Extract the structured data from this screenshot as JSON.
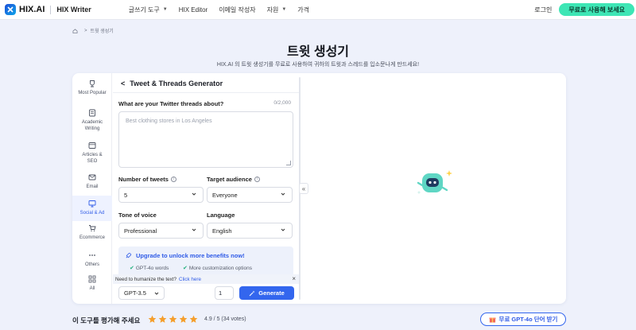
{
  "nav": {
    "logo_text": "HIX.AI",
    "product": "HIX Writer",
    "links": [
      "글쓰기 도구",
      "HIX Editor",
      "이메일 작성자",
      "자원",
      "가격"
    ],
    "login": "로그인",
    "cta": "무료로 사용해 보세요"
  },
  "breadcrumb": {
    "current": "트윗 생성기"
  },
  "header": {
    "title": "트윗 생성기",
    "subtitle": "HIX.AI 의 트윗 생성기를 무료로 사용하여 귀하의 트윗과 스레드를 입소문나게 만드세요!"
  },
  "sidebar": {
    "items": [
      {
        "label": "Most Popular",
        "icon": "trophy-icon"
      },
      {
        "label": "Academic Writing",
        "icon": "notebook-icon"
      },
      {
        "label": "Articles & SEO",
        "icon": "article-icon"
      },
      {
        "label": "Email",
        "icon": "mail-icon"
      },
      {
        "label": "Social & Ad",
        "icon": "monitor-icon",
        "active": true
      },
      {
        "label": "Ecommerce",
        "icon": "cart-icon"
      },
      {
        "label": "Others",
        "icon": "dots-icon"
      },
      {
        "label": "All",
        "icon": "grid-icon"
      }
    ]
  },
  "form": {
    "title": "Tweet & Threads Generator",
    "topic_label": "What are your Twitter threads about?",
    "topic_counter": "0/2,000",
    "topic_placeholder": "Best clothing stores in Los Angeles",
    "tweets_label": "Number of tweets",
    "tweets_value": "5",
    "audience_label": "Target audience",
    "audience_value": "Everyone",
    "tone_label": "Tone of voice",
    "tone_value": "Professional",
    "language_label": "Language",
    "language_value": "English"
  },
  "upgrade": {
    "title": "Upgrade to unlock more benefits now!",
    "benefit_1": "GPT-4o words",
    "benefit_2": "More customization options"
  },
  "humanize": {
    "text": "Need to humanize the text?",
    "link": "Click here"
  },
  "footer_bar": {
    "model": "GPT-3.5",
    "quantity": "1",
    "generate": "Generate"
  },
  "rating": {
    "prompt": "이 도구를 평가해 주세요",
    "score": "4.9 / 5 (34 votes)",
    "stars": 5,
    "free_button": "무료 GPT-4o 단어 받기"
  },
  "colors": {
    "accent": "#3366ee",
    "cta": "#3ee6b5",
    "star": "#f59e2b"
  }
}
